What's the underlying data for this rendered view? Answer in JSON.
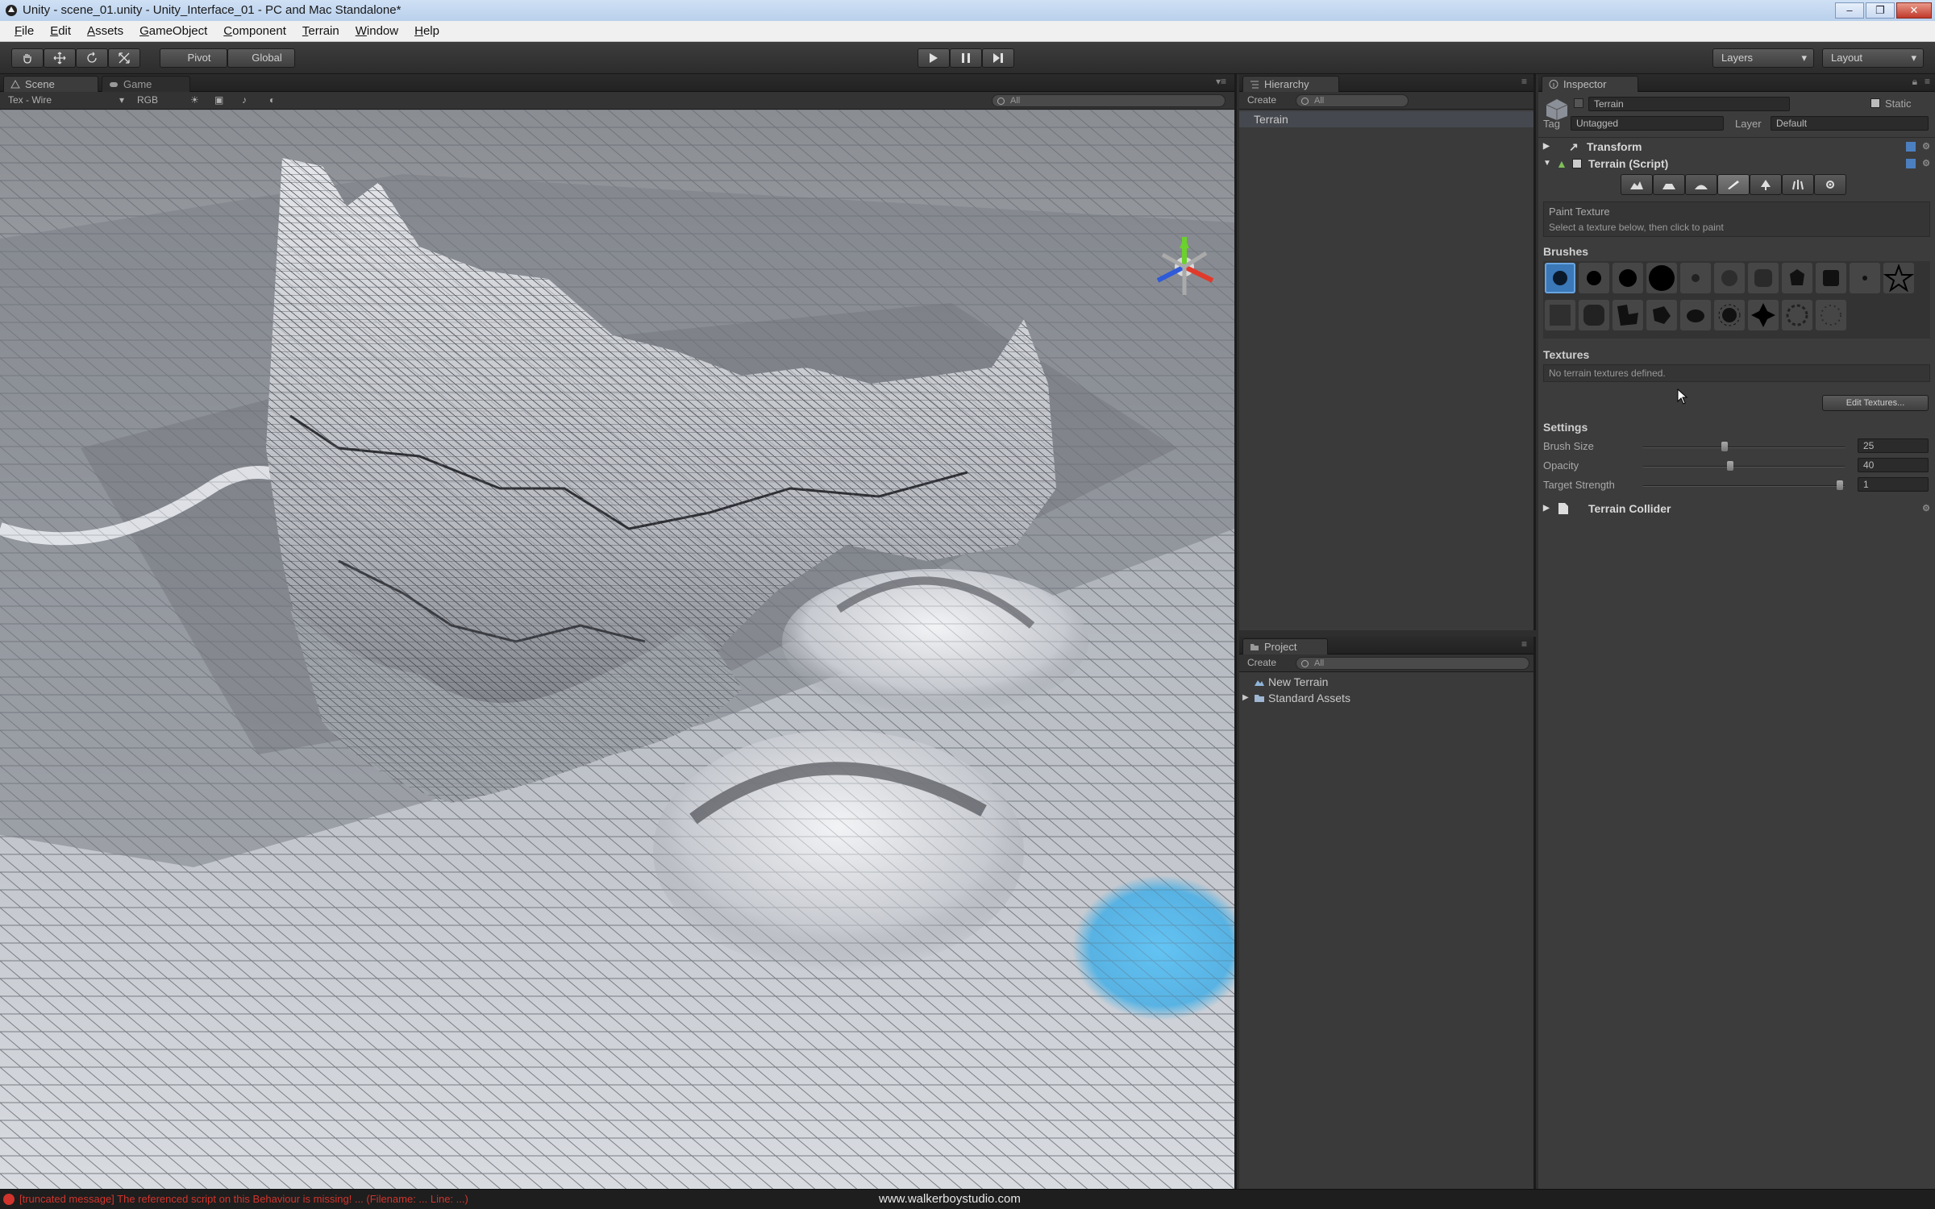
{
  "window": {
    "title": "Unity - scene_01.unity - Unity_Interface_01 - PC and Mac Standalone*",
    "controls": [
      "–",
      "❐",
      "✕"
    ]
  },
  "menu": [
    "File",
    "Edit",
    "Assets",
    "GameObject",
    "Component",
    "Terrain",
    "Window",
    "Help"
  ],
  "toolbar": {
    "pivot_label": "Pivot",
    "global_label": "Global",
    "layers_label": "Layers",
    "layout_label": "Layout"
  },
  "scene": {
    "tab_scene": "Scene",
    "tab_game": "Game",
    "render_mode": "Tex - Wire",
    "color_mode": "RGB",
    "search_placeholder": "All"
  },
  "hierarchy": {
    "tab": "Hierarchy",
    "create_label": "Create",
    "search_placeholder": "All",
    "items": [
      "Terrain"
    ]
  },
  "project": {
    "tab": "Project",
    "create_label": "Create",
    "search_placeholder": "All",
    "items": [
      "New Terrain",
      "Standard Assets"
    ]
  },
  "inspector": {
    "tab": "Inspector",
    "object_name": "Terrain",
    "static_label": "Static",
    "tag_label": "Tag",
    "tag_value": "Untagged",
    "layer_label": "Layer",
    "layer_value": "Default",
    "components": {
      "transform": "Transform",
      "terrain": "Terrain (Script)",
      "collider": "Terrain Collider"
    },
    "paint_title": "Paint Texture",
    "paint_help": "Select a texture below, then click to paint",
    "brushes_label": "Brushes",
    "textures_label": "Textures",
    "no_textures": "No terrain textures defined.",
    "edit_textures": "Edit Textures...",
    "settings_label": "Settings",
    "settings": [
      {
        "label": "Brush Size",
        "value": "25",
        "fraction": 0.4
      },
      {
        "label": "Opacity",
        "value": "40",
        "fraction": 0.43
      },
      {
        "label": "Target Strength",
        "value": "1",
        "fraction": 0.99
      }
    ]
  },
  "status": {
    "error_text": "[truncated message]  The referenced script on this Behaviour is missing!  ... (Filename: ... Line: ...)",
    "watermark": "www.walkerboystudio.com"
  },
  "colors": {
    "accent": "#3a78b8",
    "error": "#d0342c",
    "brush_overlay": "#4fb7f0"
  }
}
